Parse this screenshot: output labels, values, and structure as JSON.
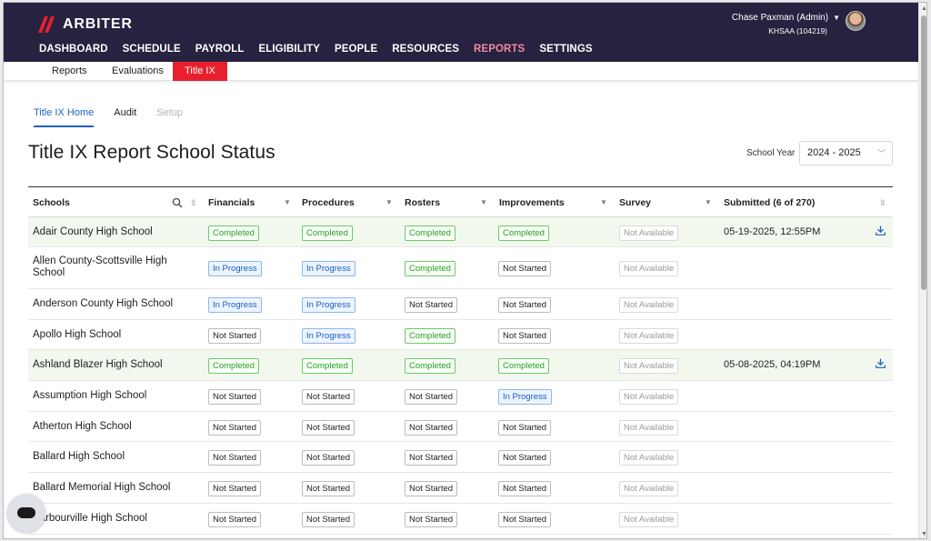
{
  "brand": {
    "name": "ARBITER",
    "accent": "#e8202d",
    "nav_bg": "#27223f"
  },
  "user": {
    "name": "Chase Paxman (Admin)",
    "org": "KHSAA (104219)"
  },
  "main_nav": [
    {
      "label": "DASHBOARD"
    },
    {
      "label": "SCHEDULE"
    },
    {
      "label": "PAYROLL"
    },
    {
      "label": "ELIGIBILITY"
    },
    {
      "label": "PEOPLE"
    },
    {
      "label": "RESOURCES"
    },
    {
      "label": "REPORTS",
      "active": true
    },
    {
      "label": "SETTINGS"
    }
  ],
  "sub_nav": [
    {
      "label": "Reports"
    },
    {
      "label": "Evaluations"
    },
    {
      "label": "Title IX",
      "active": true
    }
  ],
  "tabs": [
    {
      "label": "Title IX Home",
      "state": "active"
    },
    {
      "label": "Audit",
      "state": "normal"
    },
    {
      "label": "Setup",
      "state": "disabled"
    }
  ],
  "page": {
    "title": "Title IX Report School Status",
    "year_label": "School Year",
    "year_value": "2024 - 2025"
  },
  "table": {
    "columns": {
      "schools": "Schools",
      "financials": "Financials",
      "procedures": "Procedures",
      "rosters": "Rosters",
      "improvements": "Improvements",
      "survey": "Survey",
      "submitted": "Submitted (6 of 270)"
    },
    "rows": [
      {
        "school": "Adair County High School",
        "financials": "Completed",
        "procedures": "Completed",
        "rosters": "Completed",
        "improvements": "Completed",
        "survey": "Not Available",
        "submitted": "05-19-2025, 12:55PM",
        "highlight": true,
        "download": true
      },
      {
        "school": "Allen County-Scottsville High School",
        "financials": "In Progress",
        "procedures": "In Progress",
        "rosters": "Completed",
        "improvements": "Not Started",
        "survey": "Not Available",
        "submitted": ""
      },
      {
        "school": "Anderson County High School",
        "financials": "In Progress",
        "procedures": "In Progress",
        "rosters": "Not Started",
        "improvements": "Not Started",
        "survey": "Not Available",
        "submitted": ""
      },
      {
        "school": "Apollo High School",
        "financials": "Not Started",
        "procedures": "In Progress",
        "rosters": "Completed",
        "improvements": "Not Started",
        "survey": "Not Available",
        "submitted": ""
      },
      {
        "school": "Ashland Blazer High School",
        "financials": "Completed",
        "procedures": "Completed",
        "rosters": "Completed",
        "improvements": "Completed",
        "survey": "Not Available",
        "submitted": "05-08-2025, 04:19PM",
        "highlight": true,
        "download": true
      },
      {
        "school": "Assumption High School",
        "financials": "Not Started",
        "procedures": "Not Started",
        "rosters": "Not Started",
        "improvements": "In Progress",
        "survey": "Not Available",
        "submitted": ""
      },
      {
        "school": "Atherton High School",
        "financials": "Not Started",
        "procedures": "Not Started",
        "rosters": "Not Started",
        "improvements": "Not Started",
        "survey": "Not Available",
        "submitted": ""
      },
      {
        "school": "Ballard High School",
        "financials": "Not Started",
        "procedures": "Not Started",
        "rosters": "Not Started",
        "improvements": "Not Started",
        "survey": "Not Available",
        "submitted": ""
      },
      {
        "school": "Ballard Memorial High School",
        "financials": "Not Started",
        "procedures": "Not Started",
        "rosters": "Not Started",
        "improvements": "Not Started",
        "survey": "Not Available",
        "submitted": ""
      },
      {
        "school": "Barbourville High School",
        "financials": "Not Started",
        "procedures": "Not Started",
        "rosters": "Not Started",
        "improvements": "Not Started",
        "survey": "Not Available",
        "submitted": ""
      }
    ]
  }
}
